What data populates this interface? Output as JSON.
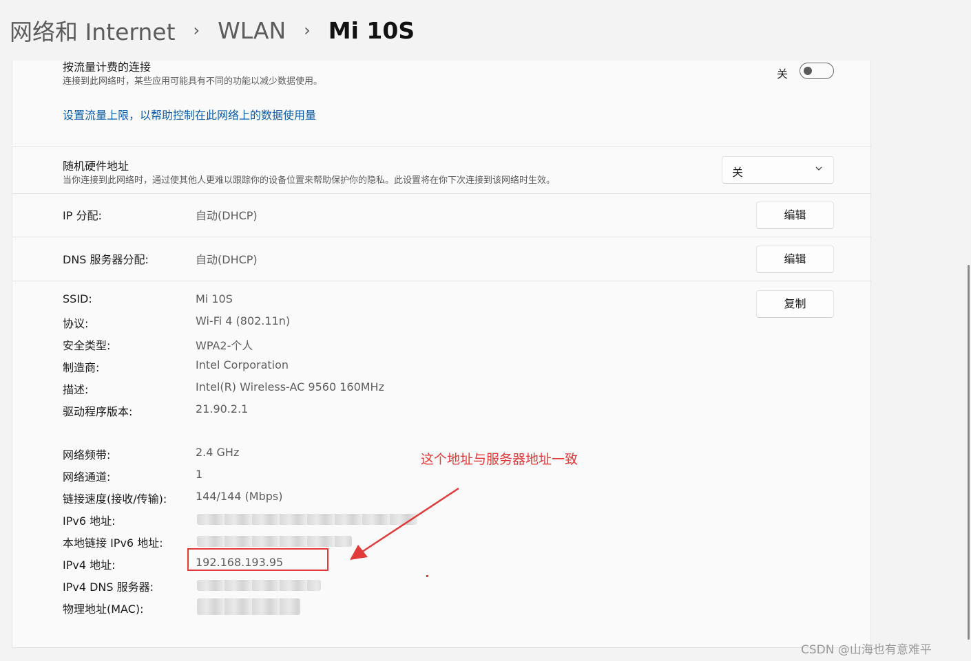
{
  "breadcrumb": {
    "items": [
      "网络和 Internet",
      "WLAN",
      "Mi 10S"
    ],
    "separator": "›"
  },
  "metered": {
    "title": "按流量计费的连接",
    "description": "连接到此网络时，某些应用可能具有不同的功能以减少数据使用。",
    "toggle_label": "关",
    "toggle_on": false,
    "link": "设置流量上限，以帮助控制在此网络上的数据使用量"
  },
  "random_mac": {
    "title": "随机硬件地址",
    "description": "当你连接到此网络时，通过使其他人更难以跟踪你的设备位置来帮助保护你的隐私。此设置将在你下次连接到该网络时生效。",
    "selected": "关"
  },
  "ip_assignment": {
    "label": "IP 分配:",
    "value": "自动(DHCP)",
    "button": "编辑"
  },
  "dns_assignment": {
    "label": "DNS 服务器分配:",
    "value": "自动(DHCP)",
    "button": "编辑"
  },
  "properties": {
    "copy_button": "复制",
    "group1": [
      {
        "label": "SSID:",
        "value": "Mi 10S"
      },
      {
        "label": "协议:",
        "value": "Wi-Fi 4 (802.11n)"
      },
      {
        "label": "安全类型:",
        "value": "WPA2-个人"
      },
      {
        "label": "制造商:",
        "value": "Intel Corporation"
      },
      {
        "label": "描述:",
        "value": "Intel(R) Wireless-AC 9560 160MHz"
      },
      {
        "label": "驱动程序版本:",
        "value": "21.90.2.1"
      }
    ],
    "group2": [
      {
        "label": "网络频带:",
        "value": "2.4 GHz"
      },
      {
        "label": "网络通道:",
        "value": "1"
      },
      {
        "label": "链接速度(接收/传输):",
        "value": "144/144 (Mbps)"
      },
      {
        "label": "IPv6 地址:",
        "value": ""
      },
      {
        "label": "本地链接 IPv6 地址:",
        "value": ""
      },
      {
        "label": "IPv4 地址:",
        "value": "192.168.193.95"
      },
      {
        "label": "IPv4 DNS 服务器:",
        "value": ""
      },
      {
        "label": "物理地址(MAC):",
        "value": ""
      }
    ]
  },
  "annotation": {
    "text": "这个地址与服务器地址一致",
    "color": "#e03a3a"
  },
  "watermark": "CSDN @山海也有意难平",
  "colors": {
    "link": "#0a5ca8",
    "annotation": "#e03a3a"
  }
}
